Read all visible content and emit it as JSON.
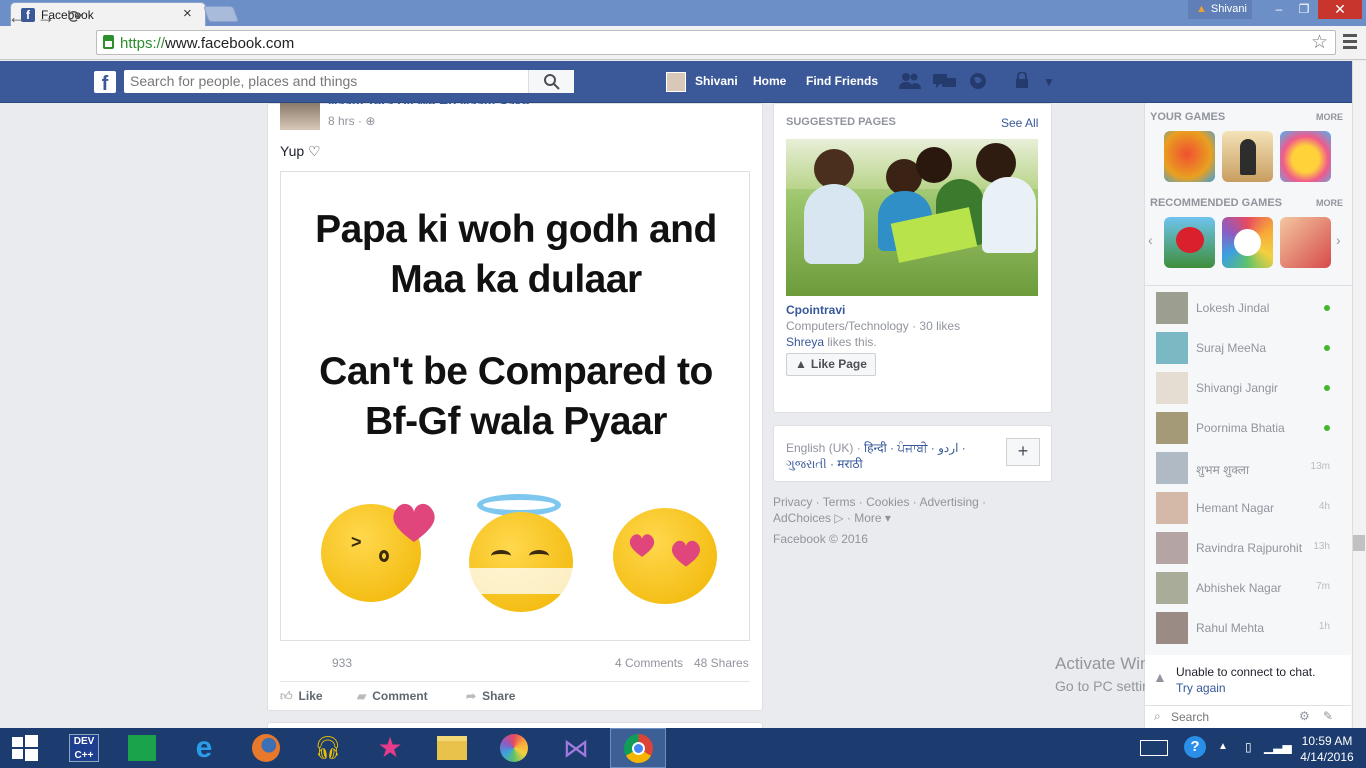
{
  "browser": {
    "tab_title": "Facebook",
    "tab_close": "×",
    "profile_name": "Shivani",
    "url_scheme": "https://",
    "url_rest": "www.facebook.com",
    "window_min": "–",
    "window_max": "❐",
    "window_close": "✕"
  },
  "fb_header": {
    "search_placeholder": "Search for people, places and things",
    "user_name": "Shivani",
    "home": "Home",
    "find_friends": "Find Friends"
  },
  "post": {
    "author": "Naam Tera Dil Me Ho Naam Sake",
    "time": "8 hrs · ",
    "text": "Yup ♡",
    "image_lines": [
      "Papa ki woh godh and",
      "Maa ka dulaar",
      "Can't be Compared to",
      "Bf-Gf wala Pyaar"
    ],
    "likes": "933",
    "comments": "4 Comments",
    "shares": "48 Shares",
    "actions": [
      "Like",
      "Comment",
      "Share"
    ]
  },
  "suggested": {
    "heading": "SUGGESTED PAGES",
    "see_all": "See All",
    "page_name": "Cpointravi",
    "category": "Computers/Technology · 30 likes",
    "liker": "Shreya",
    "likes_this": " likes this.",
    "like_button": "Like Page"
  },
  "language": {
    "current": "English (UK) · ",
    "others_line1": "हिन्दी · ਪੰਜਾਬੀ · اردو ·",
    "others_line2": "ગુજરાતી · मराठी",
    "plus": "+"
  },
  "footer": {
    "line1": "Privacy · Terms · Cookies · Advertising ·",
    "line2": "AdChoices ▷ · More ▾",
    "copyright": "Facebook © 2016"
  },
  "games": {
    "your_games": "YOUR GAMES",
    "recommended": "RECOMMENDED GAMES",
    "more": "MORE"
  },
  "chat": {
    "contacts": [
      {
        "name": "Lokesh Jindal",
        "status": "online"
      },
      {
        "name": "Suraj MeeNa",
        "status": "online"
      },
      {
        "name": "Shivangi Jangir",
        "status": "online"
      },
      {
        "name": "Poornima Bhatia",
        "status": "online"
      },
      {
        "name": "शुभम शुक्ला",
        "status": "13m"
      },
      {
        "name": "Hemant Nagar",
        "status": "4h"
      },
      {
        "name": "Ravindra Rajpurohit",
        "status": "13h"
      },
      {
        "name": "Abhishek Nagar",
        "status": "7m"
      },
      {
        "name": "Rahul Mehta",
        "status": "1h"
      }
    ],
    "error": "Unable to connect to chat.",
    "retry": "Try again",
    "search": "Search"
  },
  "watermark": {
    "line1": "Activate Windows",
    "line2": "Go to PC settings to activate Windows."
  },
  "taskbar": {
    "time": "10:59 AM",
    "date": "4/14/2016"
  },
  "colors": {
    "facebook_blue": "#3b5998",
    "link": "#365899",
    "online": "#42b72a"
  }
}
